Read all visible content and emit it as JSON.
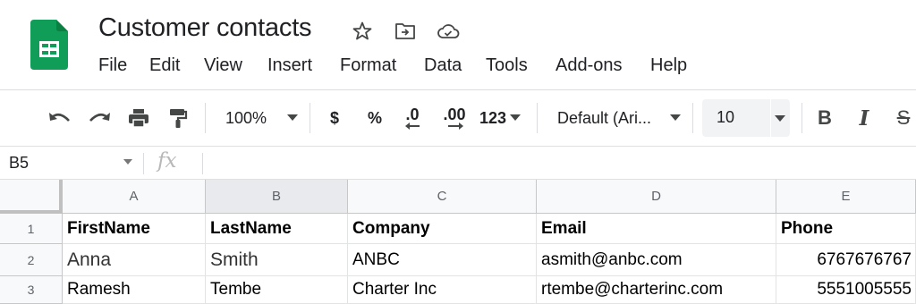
{
  "document": {
    "title": "Customer contacts"
  },
  "colors": {
    "logo_green": "#0f9d58",
    "logo_dark": "#0b8043",
    "toolbar_icon": "#444746",
    "header_bg": "#f8f9fa"
  },
  "icons": {
    "logo": "sheets-logo-icon",
    "star": "star-icon",
    "move": "move-to-folder-icon",
    "cloud": "cloud-saved-icon"
  },
  "menu": {
    "items": [
      {
        "label": "File"
      },
      {
        "label": "Edit"
      },
      {
        "label": "View"
      },
      {
        "label": "Insert"
      },
      {
        "label": "Format"
      },
      {
        "label": "Data"
      },
      {
        "label": "Tools"
      },
      {
        "label": "Add-ons"
      },
      {
        "label": "Help"
      }
    ]
  },
  "toolbar": {
    "zoom": "100%",
    "currency": "$",
    "percent": "%",
    "decrease_decimal": ".0",
    "increase_decimal": ".00",
    "more_formats": "123",
    "font": "Default (Ari...",
    "font_size": "10",
    "bold": "B",
    "italic": "I",
    "strikethrough": "S"
  },
  "formula_bar": {
    "cell_ref": "B5",
    "fx": "fx",
    "value": ""
  },
  "sheet": {
    "columns": [
      "A",
      "B",
      "C",
      "D",
      "E"
    ],
    "rows": [
      {
        "num": "1",
        "cells": [
          "FirstName",
          "LastName",
          "Company",
          "Email",
          "Phone"
        ]
      },
      {
        "num": "2",
        "cells": [
          "Anna",
          "Smith",
          "ANBC",
          "asmith@anbc.com",
          "6767676767"
        ]
      },
      {
        "num": "3",
        "cells": [
          "Ramesh",
          "Tembe",
          "Charter Inc",
          "rtembe@charterinc.com",
          "5551005555"
        ]
      }
    ]
  }
}
